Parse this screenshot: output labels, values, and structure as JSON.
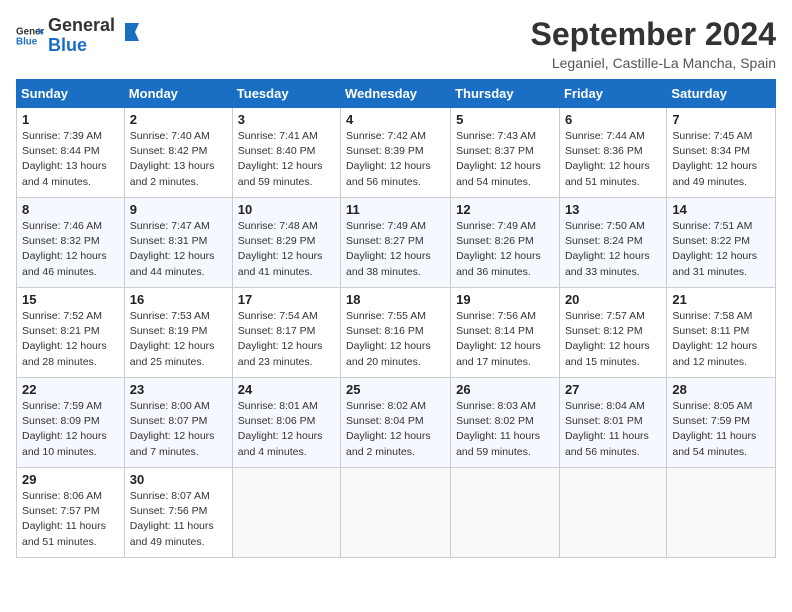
{
  "header": {
    "logo_general": "General",
    "logo_blue": "Blue",
    "month": "September 2024",
    "location": "Leganiel, Castille-La Mancha, Spain"
  },
  "days_of_week": [
    "Sunday",
    "Monday",
    "Tuesday",
    "Wednesday",
    "Thursday",
    "Friday",
    "Saturday"
  ],
  "weeks": [
    [
      {
        "day": "1",
        "info": "Sunrise: 7:39 AM\nSunset: 8:44 PM\nDaylight: 13 hours\nand 4 minutes."
      },
      {
        "day": "2",
        "info": "Sunrise: 7:40 AM\nSunset: 8:42 PM\nDaylight: 13 hours\nand 2 minutes."
      },
      {
        "day": "3",
        "info": "Sunrise: 7:41 AM\nSunset: 8:40 PM\nDaylight: 12 hours\nand 59 minutes."
      },
      {
        "day": "4",
        "info": "Sunrise: 7:42 AM\nSunset: 8:39 PM\nDaylight: 12 hours\nand 56 minutes."
      },
      {
        "day": "5",
        "info": "Sunrise: 7:43 AM\nSunset: 8:37 PM\nDaylight: 12 hours\nand 54 minutes."
      },
      {
        "day": "6",
        "info": "Sunrise: 7:44 AM\nSunset: 8:36 PM\nDaylight: 12 hours\nand 51 minutes."
      },
      {
        "day": "7",
        "info": "Sunrise: 7:45 AM\nSunset: 8:34 PM\nDaylight: 12 hours\nand 49 minutes."
      }
    ],
    [
      {
        "day": "8",
        "info": "Sunrise: 7:46 AM\nSunset: 8:32 PM\nDaylight: 12 hours\nand 46 minutes."
      },
      {
        "day": "9",
        "info": "Sunrise: 7:47 AM\nSunset: 8:31 PM\nDaylight: 12 hours\nand 44 minutes."
      },
      {
        "day": "10",
        "info": "Sunrise: 7:48 AM\nSunset: 8:29 PM\nDaylight: 12 hours\nand 41 minutes."
      },
      {
        "day": "11",
        "info": "Sunrise: 7:49 AM\nSunset: 8:27 PM\nDaylight: 12 hours\nand 38 minutes."
      },
      {
        "day": "12",
        "info": "Sunrise: 7:49 AM\nSunset: 8:26 PM\nDaylight: 12 hours\nand 36 minutes."
      },
      {
        "day": "13",
        "info": "Sunrise: 7:50 AM\nSunset: 8:24 PM\nDaylight: 12 hours\nand 33 minutes."
      },
      {
        "day": "14",
        "info": "Sunrise: 7:51 AM\nSunset: 8:22 PM\nDaylight: 12 hours\nand 31 minutes."
      }
    ],
    [
      {
        "day": "15",
        "info": "Sunrise: 7:52 AM\nSunset: 8:21 PM\nDaylight: 12 hours\nand 28 minutes."
      },
      {
        "day": "16",
        "info": "Sunrise: 7:53 AM\nSunset: 8:19 PM\nDaylight: 12 hours\nand 25 minutes."
      },
      {
        "day": "17",
        "info": "Sunrise: 7:54 AM\nSunset: 8:17 PM\nDaylight: 12 hours\nand 23 minutes."
      },
      {
        "day": "18",
        "info": "Sunrise: 7:55 AM\nSunset: 8:16 PM\nDaylight: 12 hours\nand 20 minutes."
      },
      {
        "day": "19",
        "info": "Sunrise: 7:56 AM\nSunset: 8:14 PM\nDaylight: 12 hours\nand 17 minutes."
      },
      {
        "day": "20",
        "info": "Sunrise: 7:57 AM\nSunset: 8:12 PM\nDaylight: 12 hours\nand 15 minutes."
      },
      {
        "day": "21",
        "info": "Sunrise: 7:58 AM\nSunset: 8:11 PM\nDaylight: 12 hours\nand 12 minutes."
      }
    ],
    [
      {
        "day": "22",
        "info": "Sunrise: 7:59 AM\nSunset: 8:09 PM\nDaylight: 12 hours\nand 10 minutes."
      },
      {
        "day": "23",
        "info": "Sunrise: 8:00 AM\nSunset: 8:07 PM\nDaylight: 12 hours\nand 7 minutes."
      },
      {
        "day": "24",
        "info": "Sunrise: 8:01 AM\nSunset: 8:06 PM\nDaylight: 12 hours\nand 4 minutes."
      },
      {
        "day": "25",
        "info": "Sunrise: 8:02 AM\nSunset: 8:04 PM\nDaylight: 12 hours\nand 2 minutes."
      },
      {
        "day": "26",
        "info": "Sunrise: 8:03 AM\nSunset: 8:02 PM\nDaylight: 11 hours\nand 59 minutes."
      },
      {
        "day": "27",
        "info": "Sunrise: 8:04 AM\nSunset: 8:01 PM\nDaylight: 11 hours\nand 56 minutes."
      },
      {
        "day": "28",
        "info": "Sunrise: 8:05 AM\nSunset: 7:59 PM\nDaylight: 11 hours\nand 54 minutes."
      }
    ],
    [
      {
        "day": "29",
        "info": "Sunrise: 8:06 AM\nSunset: 7:57 PM\nDaylight: 11 hours\nand 51 minutes."
      },
      {
        "day": "30",
        "info": "Sunrise: 8:07 AM\nSunset: 7:56 PM\nDaylight: 11 hours\nand 49 minutes."
      },
      {
        "day": "",
        "info": ""
      },
      {
        "day": "",
        "info": ""
      },
      {
        "day": "",
        "info": ""
      },
      {
        "day": "",
        "info": ""
      },
      {
        "day": "",
        "info": ""
      }
    ]
  ]
}
